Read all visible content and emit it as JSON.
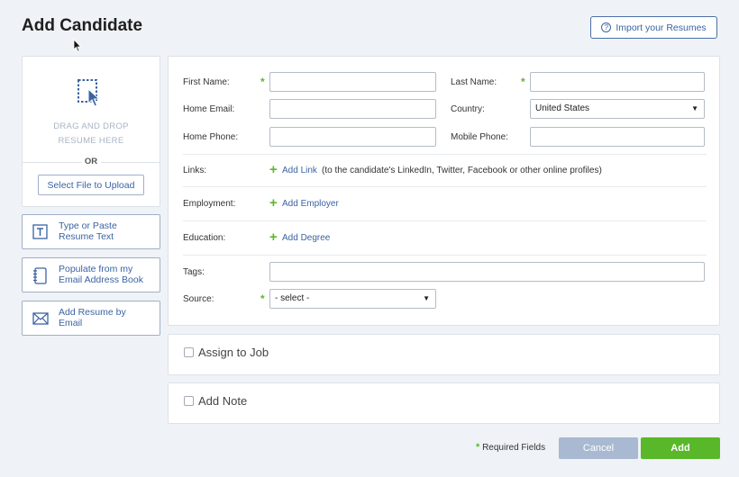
{
  "page": {
    "title": "Add Candidate"
  },
  "header": {
    "import_label": "Import your Resumes",
    "import_icon": "?"
  },
  "upload": {
    "drag_line1": "DRAG AND DROP",
    "drag_line2": "RESUME HERE",
    "or": "OR",
    "select_file": "Select File to Upload"
  },
  "side_options": [
    {
      "line1": "Type or Paste",
      "line2": "Resume Text",
      "icon": "text-box-icon"
    },
    {
      "line1": "Populate from my",
      "line2": "Email Address Book",
      "icon": "address-book-icon"
    },
    {
      "line1": "Add Resume by",
      "line2": "Email",
      "icon": "envelope-icon"
    }
  ],
  "form": {
    "first_name": {
      "label": "First Name:",
      "value": ""
    },
    "last_name": {
      "label": "Last Name:",
      "value": ""
    },
    "home_email": {
      "label": "Home Email:",
      "value": ""
    },
    "country": {
      "label": "Country:",
      "value": "United States"
    },
    "home_phone": {
      "label": "Home Phone:",
      "value": ""
    },
    "mobile_phone": {
      "label": "Mobile Phone:",
      "value": ""
    },
    "links": {
      "label": "Links:",
      "add": "Add Link",
      "note": "(to the candidate's LinkedIn, Twitter, Facebook or other online profiles)"
    },
    "employment": {
      "label": "Employment:",
      "add": "Add Employer"
    },
    "education": {
      "label": "Education:",
      "add": "Add Degree"
    },
    "tags": {
      "label": "Tags:",
      "value": ""
    },
    "source": {
      "label": "Source:",
      "value": "- select -"
    },
    "required_marker": "*"
  },
  "assign_job": {
    "label": "Assign to Job"
  },
  "add_note": {
    "label": "Add Note"
  },
  "footer": {
    "required_marker": "*",
    "required_text": "Required Fields",
    "cancel": "Cancel",
    "add": "Add"
  },
  "colors": {
    "accent_blue": "#3b63a3",
    "green": "#59b82a",
    "cancel_gray": "#a8b9d1"
  }
}
